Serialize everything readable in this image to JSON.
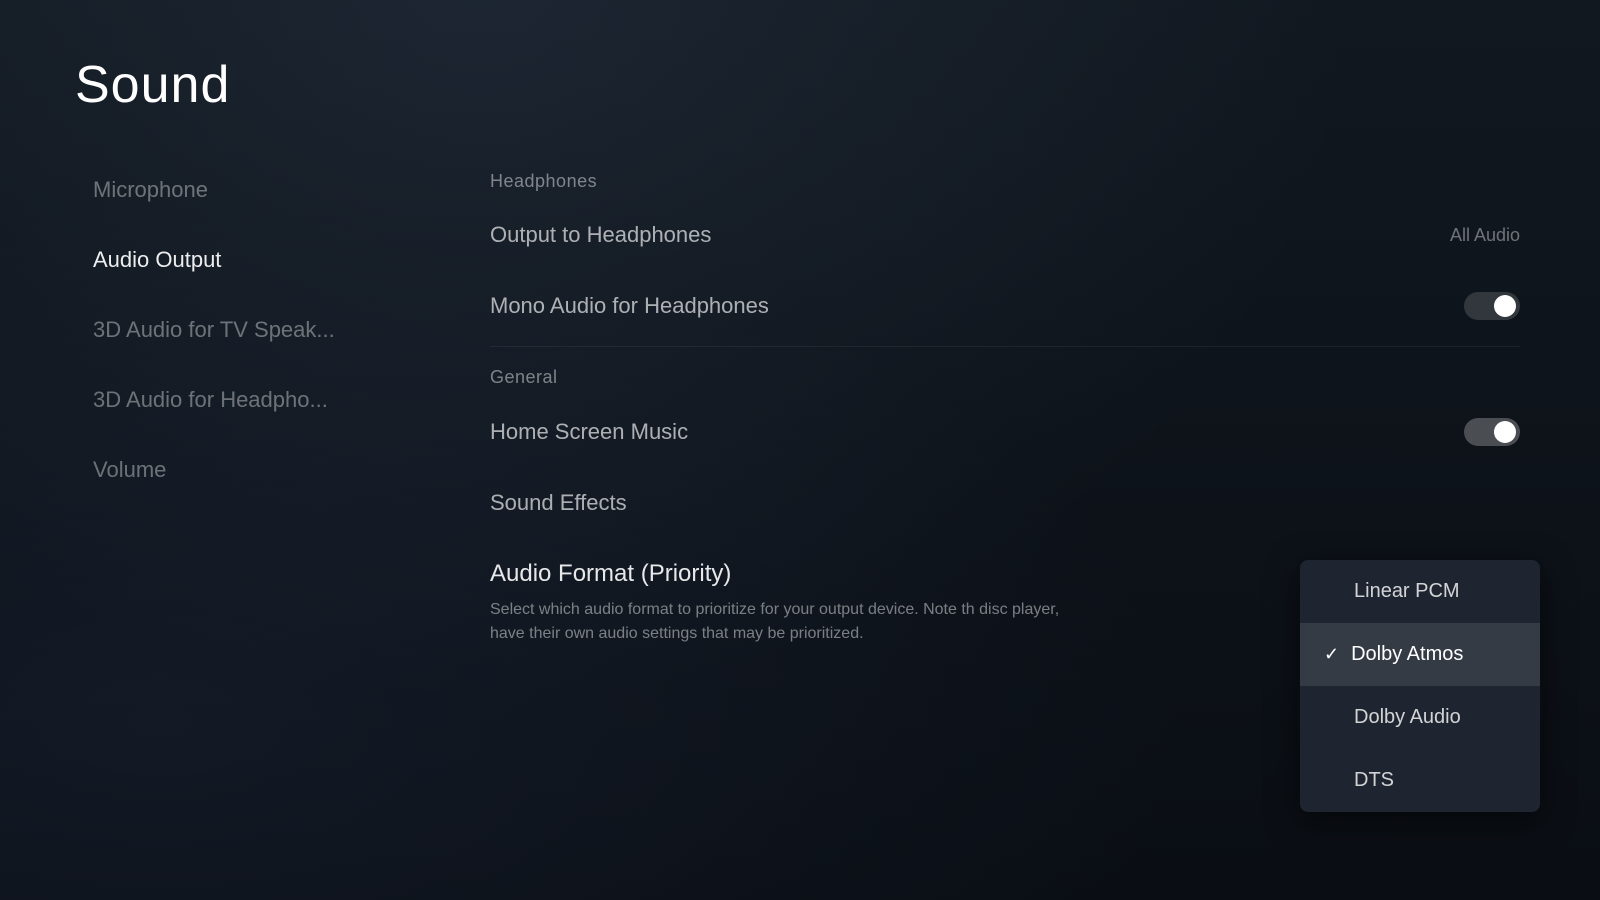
{
  "page": {
    "title": "Sound"
  },
  "sidebar": {
    "items": [
      {
        "id": "microphone",
        "label": "Microphone",
        "active": false
      },
      {
        "id": "audio-output",
        "label": "Audio Output",
        "active": true
      },
      {
        "id": "3d-tv",
        "label": "3D Audio for TV Speak...",
        "active": false
      },
      {
        "id": "3d-headphones",
        "label": "3D Audio for Headpho...",
        "active": false
      },
      {
        "id": "volume",
        "label": "Volume",
        "active": false
      }
    ]
  },
  "main": {
    "sections": [
      {
        "id": "headphones",
        "header": "Headphones",
        "settings": [
          {
            "id": "output-to-headphones",
            "label": "Output to Headphones",
            "value": "All Audio",
            "type": "value"
          },
          {
            "id": "mono-audio",
            "label": "Mono Audio for Headphones",
            "value": "",
            "type": "toggle",
            "toggleState": false
          }
        ]
      },
      {
        "id": "general",
        "header": "General",
        "settings": [
          {
            "id": "home-screen-music",
            "label": "Home Screen Music",
            "value": "",
            "type": "toggle",
            "toggleState": true
          },
          {
            "id": "sound-effects",
            "label": "Sound Effects",
            "value": "",
            "type": "none"
          }
        ]
      }
    ],
    "audioFormat": {
      "title": "Audio Format (Priority)",
      "description": "Select which audio format to prioritize for your output device. Note th disc player, have their own audio settings that may be prioritized."
    }
  },
  "dropdown": {
    "items": [
      {
        "id": "linear-pcm",
        "label": "Linear PCM",
        "selected": false
      },
      {
        "id": "dolby-atmos",
        "label": "Dolby Atmos",
        "selected": true
      },
      {
        "id": "dolby-audio",
        "label": "Dolby Audio",
        "selected": false
      },
      {
        "id": "dts",
        "label": "DTS",
        "selected": false
      }
    ]
  },
  "icons": {
    "check": "✓"
  }
}
